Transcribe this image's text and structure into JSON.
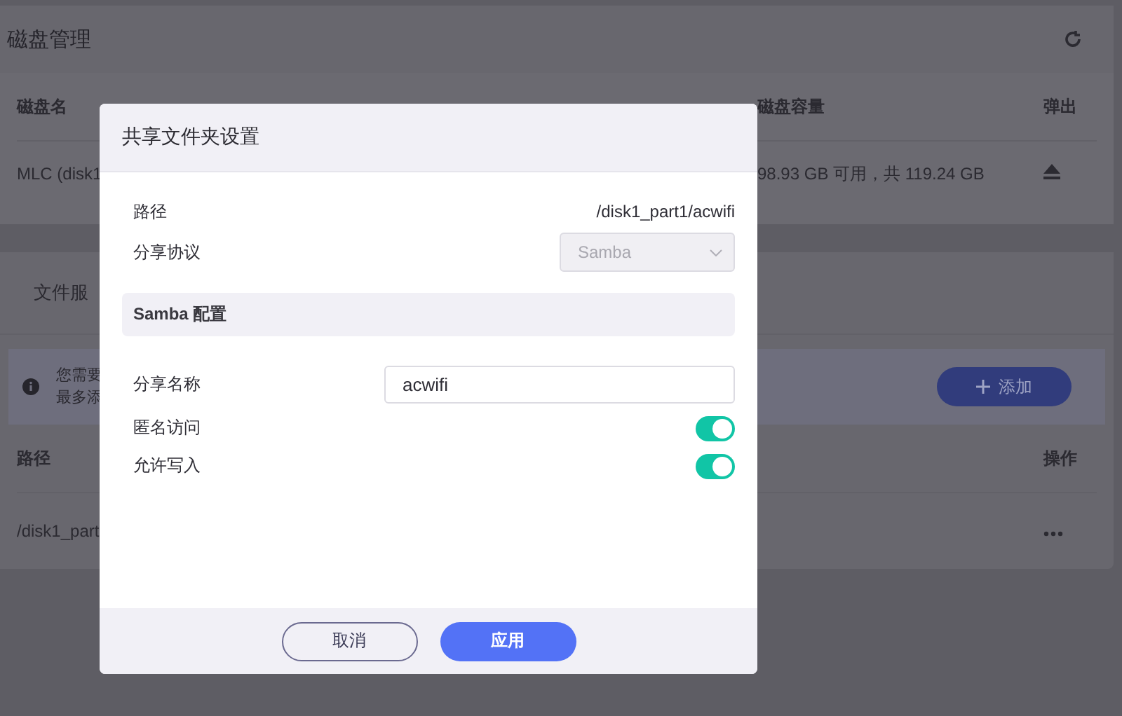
{
  "disk_panel": {
    "title": "磁盘管理",
    "columns": [
      "磁盘名",
      "磁盘容量",
      "弹出"
    ],
    "rows": [
      {
        "name": "MLC (disk1",
        "capacity": "98.93 GB 可用，共 119.24 GB"
      }
    ]
  },
  "file_panel": {
    "tabs": [
      "文件服"
    ],
    "notice": [
      "您需要",
      "最多添"
    ],
    "add_button": "添加",
    "columns": [
      "路径",
      "操作"
    ],
    "rows": [
      {
        "path": "/disk1_part"
      }
    ]
  },
  "dialog": {
    "title": "共享文件夹设置",
    "path_label": "路径",
    "path_value": "/disk1_part1/acwifi",
    "protocol_label": "分享协议",
    "protocol_value": "Samba",
    "protocol_disabled": true,
    "section_title": "Samba 配置",
    "fields": [
      {
        "kind": "text",
        "label": "分享名称",
        "value": "acwifi"
      },
      {
        "kind": "toggle",
        "label": "匿名访问",
        "on": true
      },
      {
        "kind": "toggle",
        "label": "允许写入",
        "on": true
      }
    ],
    "buttons": [
      {
        "label": "取消",
        "kind": "secondary"
      },
      {
        "label": "应用",
        "kind": "primary"
      }
    ]
  }
}
